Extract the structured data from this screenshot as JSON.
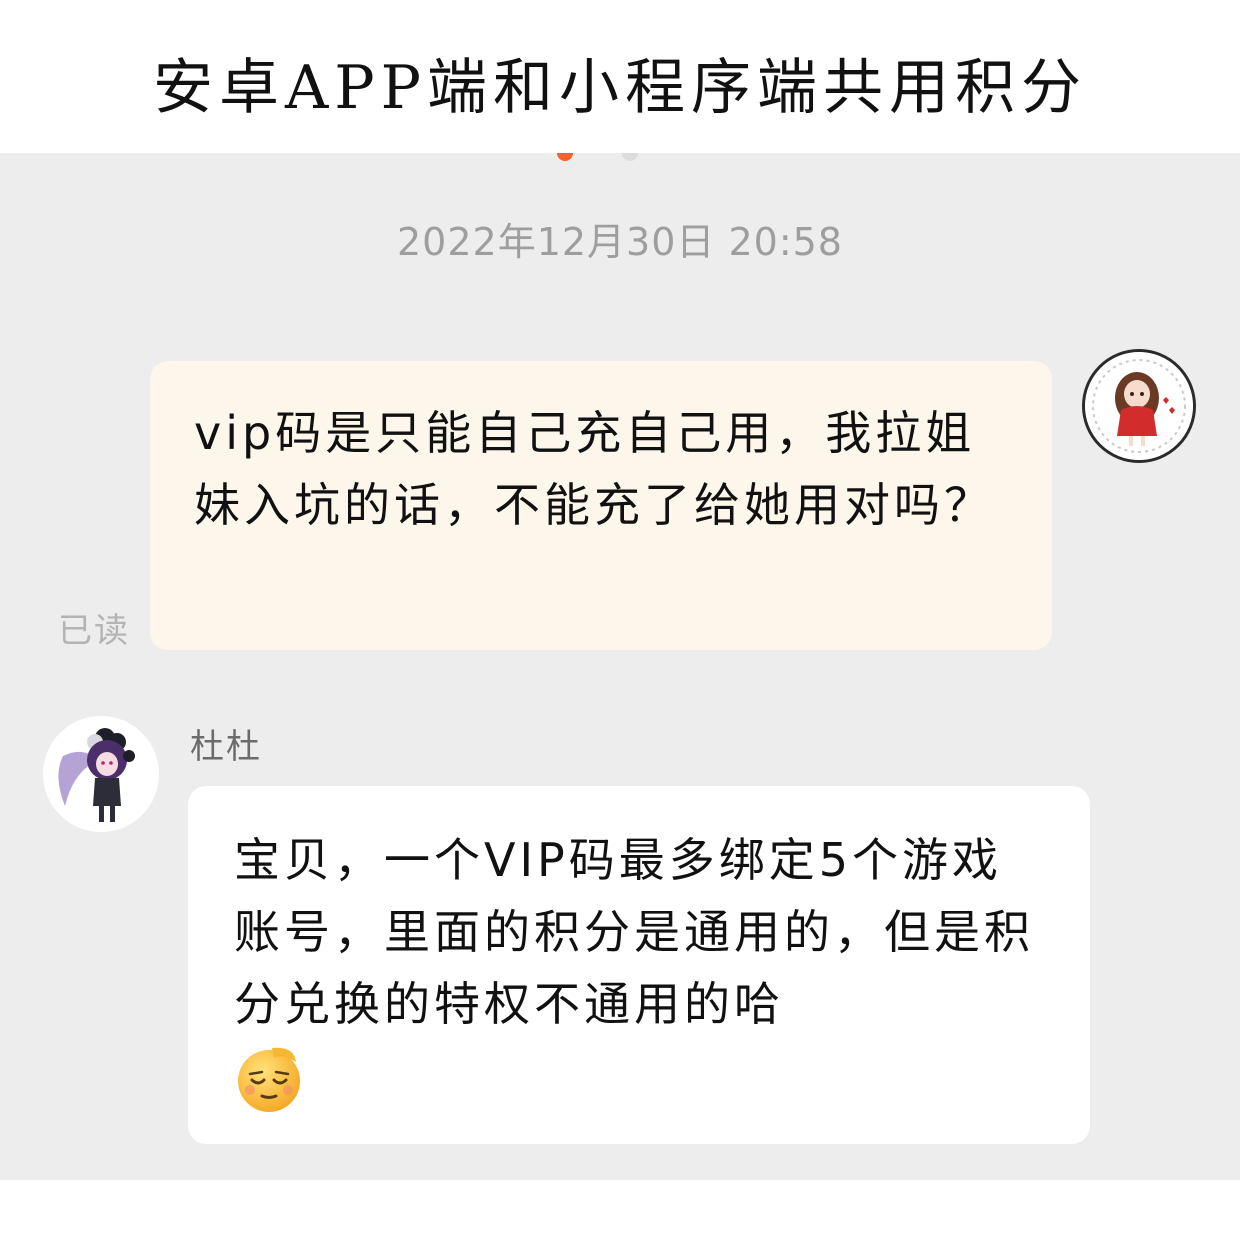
{
  "header": {
    "title": "安卓APP端和小程序端共用积分"
  },
  "chat": {
    "timestamp": "2022年12月30日 20:58",
    "outgoing": {
      "text": "vip码是只能自己充自己用，我拉姐妹入坑的话，不能充了给她用对吗？",
      "read_status": "已读"
    },
    "incoming": {
      "sender": "杜杜",
      "text": "宝贝，一个VIP码最多绑定5个游戏账号，里面的积分是通用的，但是积分兑换的特权不通用的哈",
      "emoji": "relieved-face-icon"
    }
  },
  "colors": {
    "accent": "#f0632c",
    "chat_bg": "#ededed",
    "outgoing_bubble": "#fdf6ea",
    "incoming_bubble": "#ffffff"
  }
}
